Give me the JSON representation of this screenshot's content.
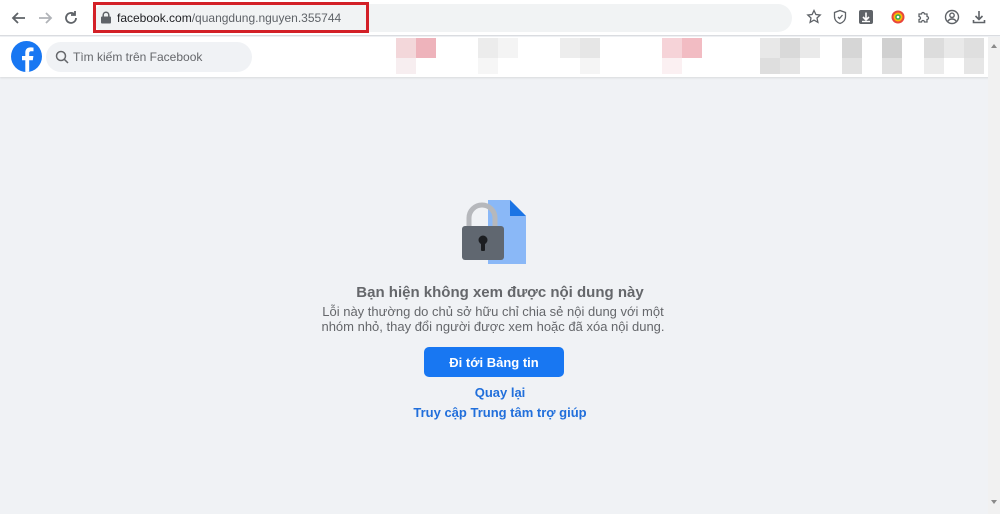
{
  "browser": {
    "url_domain": "facebook.com",
    "url_path": "/quangdung.nguyen.355744"
  },
  "header": {
    "search_placeholder": "Tìm kiếm trên Facebook"
  },
  "main": {
    "title": "Bạn hiện không xem được nội dung này",
    "description": "Lỗi này thường do chủ sở hữu chỉ chia sẻ nội dung với một nhóm nhỏ, thay đổi người được xem hoặc đã xóa nội dung.",
    "primary_button": "Đi tới Bảng tin",
    "back_link": "Quay lại",
    "help_link": "Truy cập Trung tâm trợ giúp"
  },
  "colors": {
    "brand": "#1877f2",
    "link": "#216fdb",
    "url_highlight": "#d32027"
  }
}
